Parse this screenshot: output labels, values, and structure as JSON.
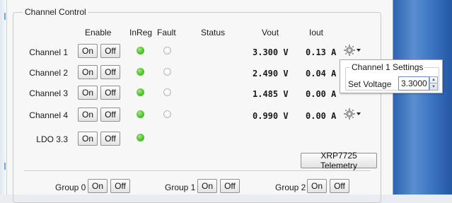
{
  "groupbox": {
    "title": "Channel Control"
  },
  "headers": {
    "enable": "Enable",
    "inreg": "InReg",
    "fault": "Fault",
    "status": "Status",
    "vout": "Vout",
    "iout": "Iout"
  },
  "channels": [
    {
      "label": "Channel 1",
      "on": "On",
      "off": "Off",
      "inreg": "on",
      "fault": "off",
      "vout": "3.300 V",
      "iout": "0.13 A",
      "has_settings": true
    },
    {
      "label": "Channel 2",
      "on": "On",
      "off": "Off",
      "inreg": "on",
      "fault": "off",
      "vout": "2.490 V",
      "iout": "0.04 A",
      "has_settings": false
    },
    {
      "label": "Channel 3",
      "on": "On",
      "off": "Off",
      "inreg": "on",
      "fault": "off",
      "vout": "1.485 V",
      "iout": "0.00 A",
      "has_settings": false
    },
    {
      "label": "Channel 4",
      "on": "On",
      "off": "Off",
      "inreg": "on",
      "fault": "off",
      "vout": "0.990 V",
      "iout": "0.00 A",
      "has_settings": true
    },
    {
      "label": "LDO 3.3",
      "on": "On",
      "off": "Off",
      "inreg": "on"
    }
  ],
  "telemetry_button": "XRP7725 Telemetry",
  "groups": [
    {
      "label": "Group 0",
      "on": "On",
      "off": "Off"
    },
    {
      "label": "Group 1",
      "on": "On",
      "off": "Off"
    },
    {
      "label": "Group 2",
      "on": "On",
      "off": "Off"
    }
  ],
  "popup": {
    "title": "Channel 1 Settings",
    "field_label": "Set Voltage",
    "value": "3.3000"
  },
  "icons": {
    "settings": "gear-icon",
    "dropdown": "dropdown-arrow-icon",
    "spin_up": "spin-up-icon",
    "spin_down": "spin-down-icon"
  },
  "colors": {
    "led_on": "#4cbb2b",
    "led_off": "#f2f2f2",
    "desktop": "#3d74c4"
  }
}
